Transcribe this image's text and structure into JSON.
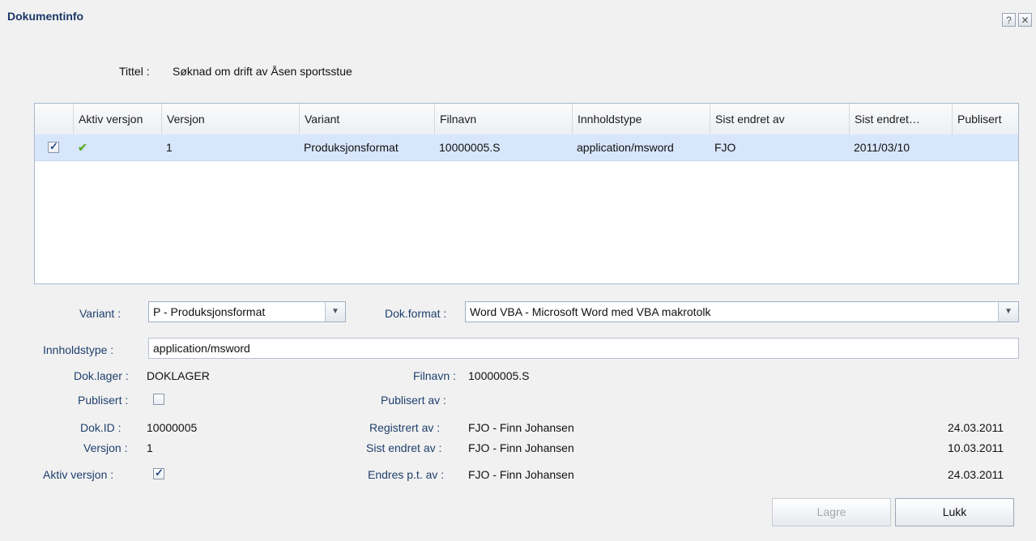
{
  "window": {
    "title": "Dokumentinfo",
    "help_label": "?",
    "close_label": "✕"
  },
  "tittel": {
    "label": "Tittel :",
    "value": "Søknad om drift av Åsen sportsstue"
  },
  "grid": {
    "headers": [
      "Aktiv versjon",
      "Versjon",
      "Variant",
      "Filnavn",
      "Innholdstype",
      "Sist endret av",
      "Sist endret…",
      "Publisert"
    ],
    "rows": [
      {
        "selected": true,
        "aktiv": "✔",
        "versjon": "1",
        "variant": "Produksjonsformat",
        "filnavn": "10000005.S",
        "innholdstype": "application/msword",
        "sist_endret_av": "FJO",
        "sist_endret": "2011/03/10",
        "publisert": ""
      }
    ]
  },
  "form": {
    "variant_label": "Variant :",
    "variant_value": "P - Produksjonsformat",
    "dokformat_label": "Dok.format :",
    "dokformat_value": "Word VBA - Microsoft Word med VBA makrotolk",
    "innholdstype_label": "Innholdstype :",
    "innholdstype_value": "application/msword",
    "doklager_label": "Dok.lager :",
    "doklager_value": "DOKLAGER",
    "filnavn_label": "Filnavn :",
    "filnavn_value": "10000005.S",
    "publisert_label": "Publisert :",
    "publisert_checked": false,
    "publisert_av_label": "Publisert av :",
    "publisert_av_value": "",
    "dokid_label": "Dok.ID :",
    "dokid_value": "10000005",
    "versjon_label": "Versjon :",
    "versjon_value": "1",
    "aktiv_label": "Aktiv versjon :",
    "aktiv_checked": true,
    "registrert_label": "Registrert av :",
    "registrert_value": "FJO - Finn Johansen",
    "registrert_date": "24.03.2011",
    "sist_endret_label": "Sist endret av :",
    "sist_endret_value": "FJO - Finn Johansen",
    "sist_endret_date": "10.03.2011",
    "endres_label": "Endres p.t. av :",
    "endres_value": "FJO - Finn Johansen",
    "endres_date": "24.03.2011"
  },
  "buttons": {
    "lagre": "Lagre",
    "lukk": "Lukk"
  },
  "icons": {
    "check": "check-icon",
    "dropdown": "chevron-down-icon"
  }
}
